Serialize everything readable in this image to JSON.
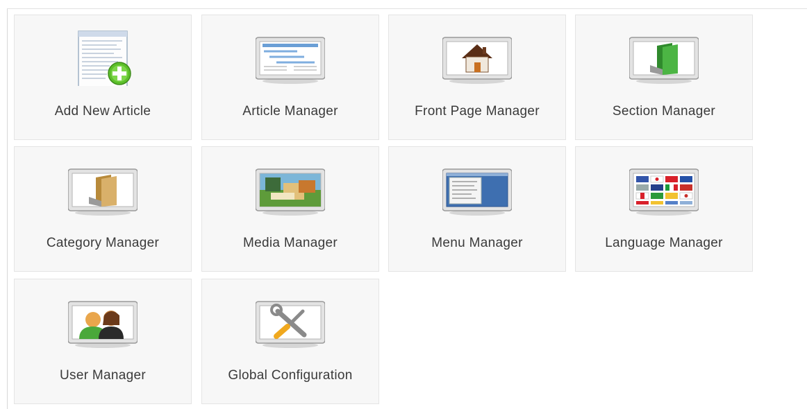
{
  "control_panel": {
    "tiles": [
      {
        "label": "Add New Article",
        "icon": "add-article-icon"
      },
      {
        "label": "Article Manager",
        "icon": "article-manager-icon"
      },
      {
        "label": "Front Page Manager",
        "icon": "front-page-home-icon"
      },
      {
        "label": "Section Manager",
        "icon": "section-folder-icon"
      },
      {
        "label": "Category Manager",
        "icon": "category-folder-icon"
      },
      {
        "label": "Media Manager",
        "icon": "media-image-icon"
      },
      {
        "label": "Menu Manager",
        "icon": "menu-manager-icon"
      },
      {
        "label": "Language Manager",
        "icon": "language-flags-icon"
      },
      {
        "label": "User Manager",
        "icon": "users-icon"
      },
      {
        "label": "Global Configuration",
        "icon": "tools-config-icon"
      }
    ]
  },
  "colors": {
    "tile_background": "#f7f7f7",
    "tile_border": "#e4e4e4",
    "label_text": "#3a3a3a",
    "add_badge": "#5cbf2a",
    "section_green": "#3fa33a",
    "category_tan": "#d9b06a",
    "menu_blue": "#3e6fb0"
  }
}
